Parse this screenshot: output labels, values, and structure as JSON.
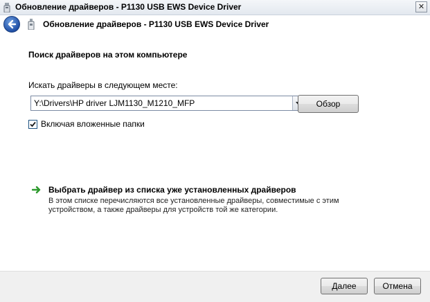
{
  "window": {
    "title": "Обновление драйверов - P1130 USB EWS Device Driver",
    "close_label": "✕"
  },
  "header": {
    "heading": "Обновление драйверов - P1130 USB EWS Device Driver"
  },
  "main": {
    "section_title": "Поиск драйверов на этом компьютере",
    "search_label": "Искать драйверы в следующем месте:",
    "path_value": "Y:\\Drivers\\HP driver LJM1130_M1210_MFP",
    "browse_label": "Обзор",
    "include_subfolders_label": "Включая вложенные папки",
    "include_subfolders_checked": true,
    "pick_link": {
      "title": "Выбрать драйвер из списка уже установленных драйверов",
      "description": "В этом списке перечисляются все установленные драйверы, совместимые с этим устройством, а также драйверы для устройств той же категории."
    }
  },
  "footer": {
    "next_label": "Далее",
    "cancel_label": "Отмена"
  },
  "colors": {
    "accent": "#1f4fa6",
    "link_arrow": "#2e9a2e",
    "footer_bg": "#f0f0f0"
  },
  "icons": {
    "app": "device-driver-icon",
    "back": "back-arrow-icon",
    "device": "usb-device-icon",
    "dropdown": "chevron-down-icon",
    "check": "checkmark-icon",
    "link": "green-arrow-icon"
  }
}
